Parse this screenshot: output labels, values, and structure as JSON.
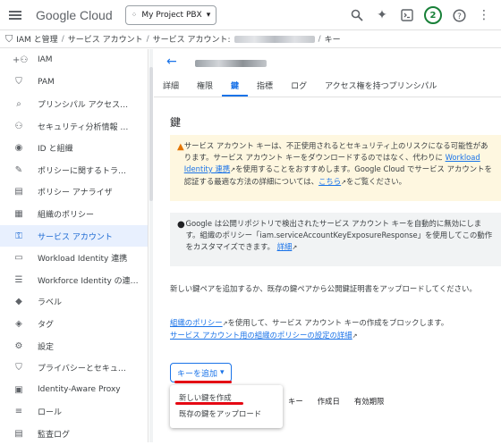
{
  "topbar": {
    "logo_google": "Google",
    "logo_cloud": "Cloud",
    "project": "My Project PBX",
    "badge": "2"
  },
  "breadcrumb": {
    "iam": "IAM と管理",
    "sa": "サービス アカウント",
    "sa_detail": "サービス アカウント:",
    "key": "キー"
  },
  "sidebar": {
    "items": [
      {
        "label": "IAM",
        "icon": "person-add-icon"
      },
      {
        "label": "PAM",
        "icon": "shield-icon"
      },
      {
        "label": "プリンシパル アクセス…",
        "icon": "search-person-icon"
      },
      {
        "label": "セキュリティ分析情報 …",
        "icon": "people-icon"
      },
      {
        "label": "ID と組織",
        "icon": "id-icon"
      },
      {
        "label": "ポリシーに関するトラ…",
        "icon": "wrench-icon"
      },
      {
        "label": "ポリシー アナライザ",
        "icon": "document-search-icon"
      },
      {
        "label": "組織のポリシー",
        "icon": "list-icon"
      },
      {
        "label": "サービス アカウント",
        "icon": "service-account-icon"
      },
      {
        "label": "Workload Identity 連携",
        "icon": "workload-icon"
      },
      {
        "label": "Workforce Identity の連…",
        "icon": "list-lines-icon"
      },
      {
        "label": "ラベル",
        "icon": "label-icon"
      },
      {
        "label": "タグ",
        "icon": "tag-icon"
      },
      {
        "label": "設定",
        "icon": "gear-icon"
      },
      {
        "label": "プライバシーとセキュ…",
        "icon": "shield-lock-icon"
      },
      {
        "label": "Identity-Aware Proxy",
        "icon": "proxy-icon"
      },
      {
        "label": "ロール",
        "icon": "roles-icon"
      },
      {
        "label": "監査ログ",
        "icon": "audit-icon"
      }
    ],
    "active_index": 8
  },
  "tabs": [
    "詳細",
    "権限",
    "鍵",
    "指標",
    "ログ",
    "アクセス権を持つプリンシパル"
  ],
  "active_tab": 2,
  "page": {
    "heading": "鍵",
    "warning_pre": "サービス アカウント キーは、不正使用されるとセキュリティ上のリスクになる可能性があります。サービス アカウント キーをダウンロードするのではなく、代わりに",
    "warning_link": "Workload Identity 連携",
    "warning_mid": "を使用することをおすすめします。Google Cloud でサービス アカウントを認証する最適な方法の詳細については、",
    "warning_link2": "こちら",
    "warning_post": "をご覧ください。",
    "info_text": "Google は公開リポジトリで検出されたサービス アカウント キーを自動的に無効にします。組織のポリシー「iam.serviceAccountKeyExposureResponse」を使用してこの動作をカスタマイズできます。",
    "info_link": "詳細",
    "add_text": "新しい鍵ペアを追加するか、既存の鍵ペアから公開鍵証明書をアップロードしてください。",
    "policy_link": "組織のポリシー",
    "policy_text": "を使用して、サービス アカウント キーの作成をブロックします。",
    "policy_detail_link": "サービス アカウント用の組織のポリシーの設定の詳細",
    "add_key_button": "キーを追加",
    "table_headers": [
      "キー",
      "作成日",
      "有効期限"
    ],
    "menu_items": [
      "新しい鍵を作成",
      "既存の鍵をアップロード"
    ]
  }
}
